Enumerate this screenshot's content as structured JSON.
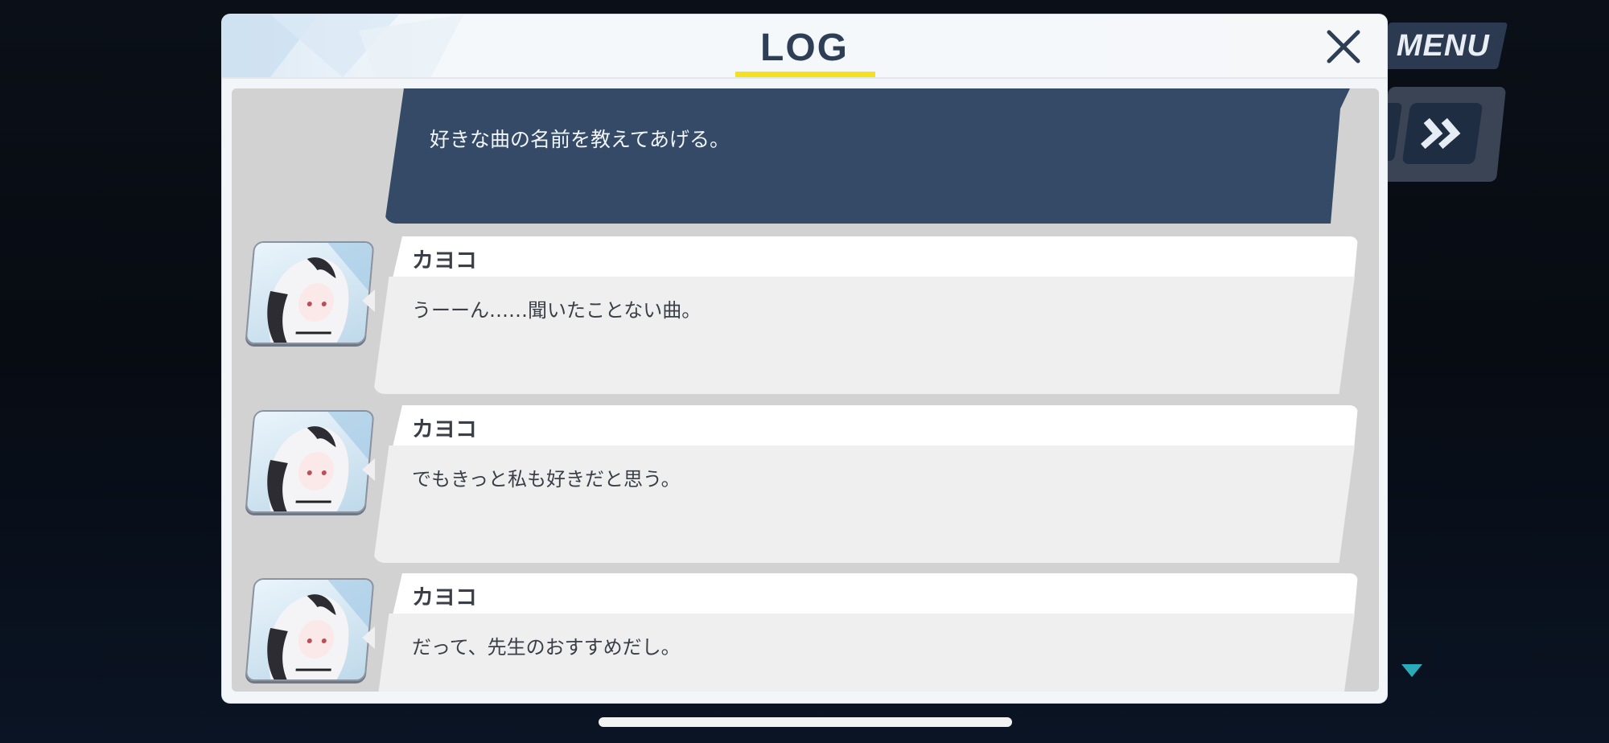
{
  "dialog": {
    "title": "LOG",
    "close_label": "close"
  },
  "hud": {
    "menu_label": "MENU",
    "fast_forward_icon": "double-chevron-right-icon"
  },
  "narration": {
    "text": "好きな曲の名前を教えてあげる。"
  },
  "entries": [
    {
      "speaker": "カヨコ",
      "text": "うーーん……聞いたことない曲。"
    },
    {
      "speaker": "カヨコ",
      "text": "でもきっと私も好きだと思う。"
    },
    {
      "speaker": "カヨコ",
      "text": "だって、先生のおすすめだし。"
    }
  ],
  "colors": {
    "accent_underline": "#f5e21e",
    "narration_bg": "#344a66",
    "scroll_arrow": "#2aa9b8"
  }
}
